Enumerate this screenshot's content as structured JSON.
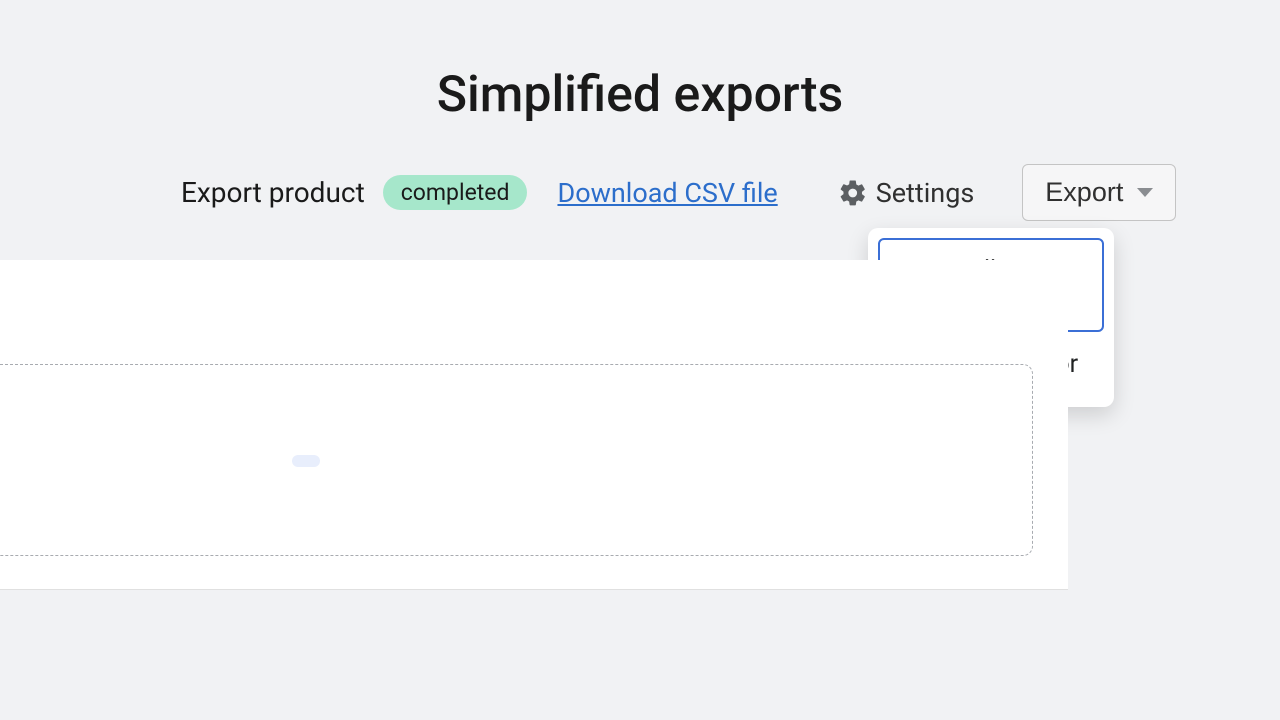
{
  "title": "Simplified exports",
  "toolbar": {
    "export_label": "Export product",
    "status_badge": "completed",
    "download_link": "Download CSV file",
    "settings_label": "Settings",
    "export_button": "Export"
  },
  "dropdown": {
    "items": [
      {
        "label": "Export all products"
      },
      {
        "label": "Export by vendor"
      }
    ]
  },
  "colors": {
    "badge_bg": "#a6e7cb",
    "link": "#2c6ecb",
    "accent": "#3b6fd6"
  }
}
